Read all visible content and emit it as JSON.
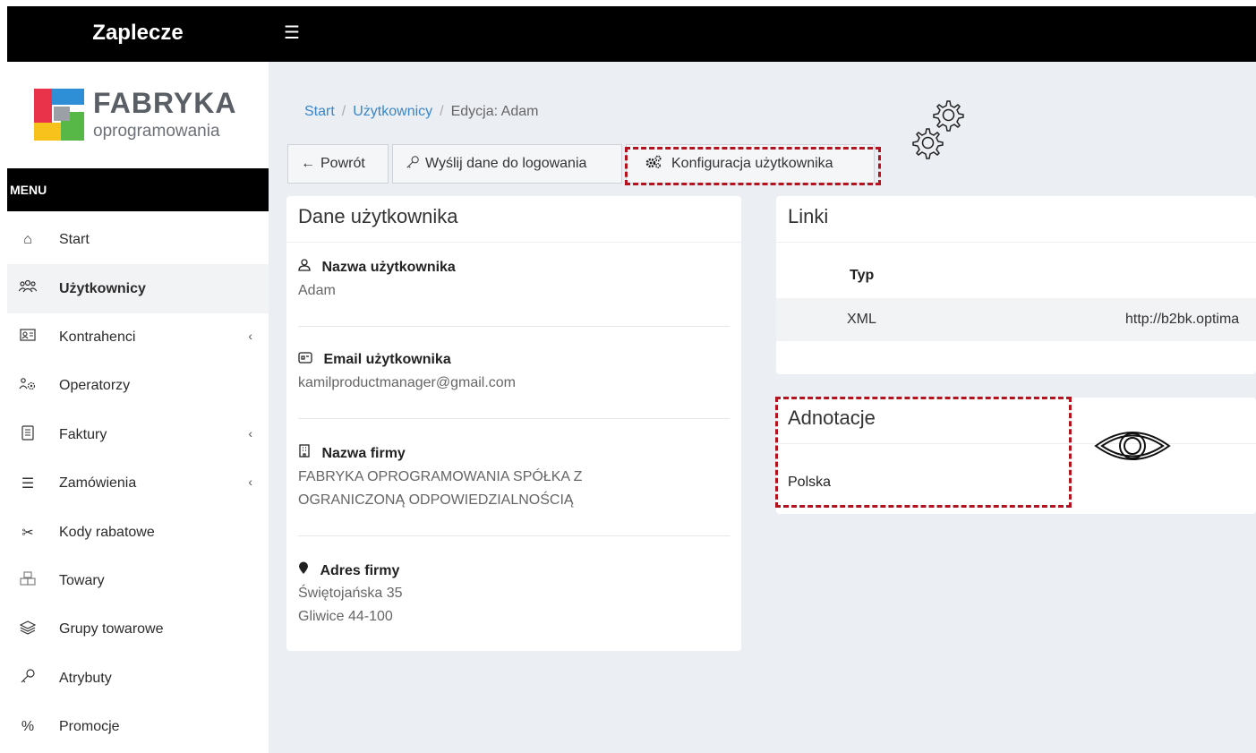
{
  "app": {
    "title": "Zaplecze",
    "menu_toggle_icon": "hamburger-icon"
  },
  "logo": {
    "title": "FABRYKA",
    "subtitle": "oprogramowania"
  },
  "sidebar": {
    "menu_label": "MENU",
    "items": [
      {
        "label": "Start",
        "icon": "home-icon",
        "has_submenu": false,
        "active": false
      },
      {
        "label": "Użytkownicy",
        "icon": "users-icon",
        "has_submenu": false,
        "active": true
      },
      {
        "label": "Kontrahenci",
        "icon": "id-card-icon",
        "has_submenu": true,
        "active": false
      },
      {
        "label": "Operatorzy",
        "icon": "operators-icon",
        "has_submenu": false,
        "active": false
      },
      {
        "label": "Faktury",
        "icon": "invoice-icon",
        "has_submenu": true,
        "active": false
      },
      {
        "label": "Zamówienia",
        "icon": "list-icon",
        "has_submenu": true,
        "active": false
      },
      {
        "label": "Kody rabatowe",
        "icon": "scissors-icon",
        "has_submenu": false,
        "active": false
      },
      {
        "label": "Towary",
        "icon": "boxes-icon",
        "has_submenu": false,
        "active": false
      },
      {
        "label": "Grupy towarowe",
        "icon": "layers-icon",
        "has_submenu": false,
        "active": false
      },
      {
        "label": "Atrybuty",
        "icon": "key-icon",
        "has_submenu": false,
        "active": false
      },
      {
        "label": "Promocje",
        "icon": "percent-icon",
        "has_submenu": false,
        "active": false
      }
    ]
  },
  "breadcrumb": {
    "start": "Start",
    "users": "Użytkownicy",
    "current": "Edycja: Adam"
  },
  "toolbar": {
    "back_label": "Powrót",
    "send_login_label": "Wyślij dane do logowania",
    "config_label": "Konfiguracja użytkownika"
  },
  "user_card": {
    "title": "Dane użytkownika",
    "username_label": "Nazwa użytkownika",
    "username": "Adam",
    "email_label": "Email użytkownika",
    "email": "kamilproductmanager@gmail.com",
    "company_label": "Nazwa firmy",
    "company": "FABRYKA OPROGRAMOWANIA SPÓŁKA Z OGRANICZONĄ ODPOWIEDZIALNOŚCIĄ",
    "address_label": "Adres firmy",
    "address_line1": "Świętojańska 35",
    "address_line2": "Gliwice 44-100"
  },
  "links_card": {
    "title": "Linki",
    "header_type": "Typ",
    "rows": [
      {
        "type": "XML",
        "url": "http://b2bk.optima"
      }
    ]
  },
  "notes_card": {
    "title": "Adnotacje",
    "text": "Polska"
  },
  "colors": {
    "highlight": "#b3121f",
    "link": "#3a86c8",
    "topbar": "#000000"
  }
}
